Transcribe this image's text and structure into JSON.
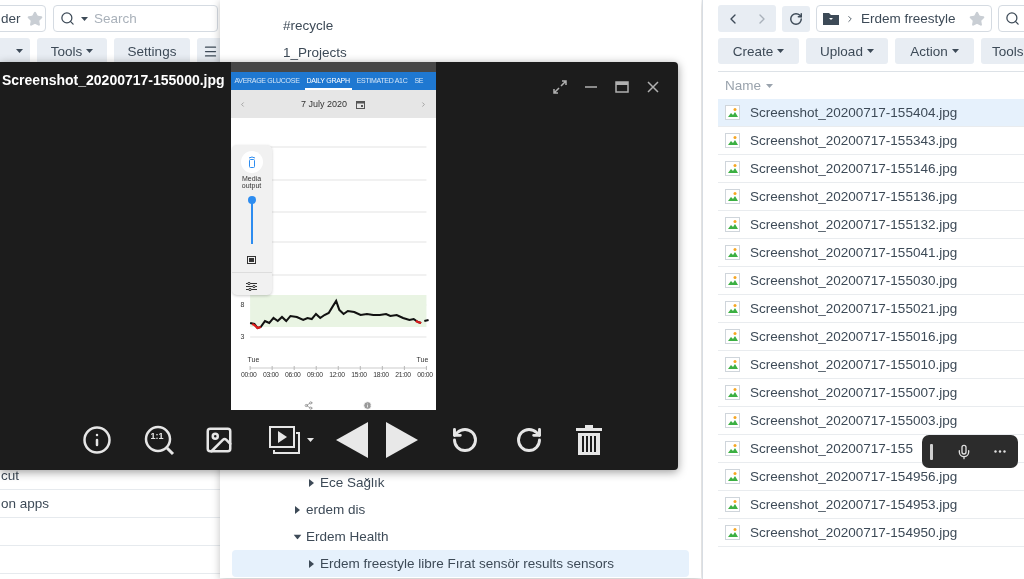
{
  "left_window": {
    "path_field": {
      "text": "der",
      "starred": false
    },
    "search": {
      "placeholder": "Search"
    },
    "toolbar": [
      {
        "kind": "caret"
      },
      {
        "kind": "dropdown",
        "label": "Tools"
      },
      {
        "kind": "plain",
        "label": "Settings"
      },
      {
        "kind": "menu"
      }
    ],
    "list": [
      "cut",
      "on apps"
    ]
  },
  "folder_tree": {
    "top": [
      {
        "label": "#recycle"
      },
      {
        "label": "1_Projects"
      }
    ],
    "bottom": [
      {
        "children": [
          {
            "label": "Ece Sağlık",
            "expanded": false,
            "selected": false
          }
        ]
      },
      {
        "label": "erdem dis",
        "expanded": false,
        "selected": false
      },
      {
        "label": "Erdem Health",
        "expanded": true,
        "selected": false,
        "children": [
          {
            "label": "Erdem freestyle libre Fırat sensör results sensors",
            "expanded": false,
            "selected": true
          }
        ]
      }
    ]
  },
  "viewer": {
    "title": "Screenshot_20200717-155000.jpg",
    "actual_size_label": "1:1",
    "image": {
      "tabs": [
        {
          "label": "AVERAGE GLUCOSE",
          "selected": false
        },
        {
          "label": "DAILY GRAPH",
          "selected": true
        },
        {
          "label": "ESTIMATED A1C",
          "selected": false
        },
        {
          "label": "SE",
          "selected": false
        }
      ],
      "date": "7 July 2020",
      "media_output": {
        "label": "Media output",
        "level": 0.95
      },
      "y_labels": [
        "8",
        "3"
      ],
      "day_labels": [
        "Tue",
        "Tue"
      ],
      "time_labels": [
        "00:00",
        "03:00",
        "06:00",
        "09:00",
        "12:00",
        "15:00",
        "18:00",
        "21:00",
        "00:00"
      ]
    }
  },
  "right_window": {
    "breadcrumb": {
      "folder": "Erdem freestyle",
      "starred": false
    },
    "toolbar": [
      "Create",
      "Upload",
      "Action",
      "Tools"
    ],
    "column": "Name",
    "files": [
      {
        "name": "Screenshot_20200717-155404.jpg",
        "selected": true
      },
      {
        "name": "Screenshot_20200717-155343.jpg",
        "selected": false
      },
      {
        "name": "Screenshot_20200717-155146.jpg",
        "selected": false
      },
      {
        "name": "Screenshot_20200717-155136.jpg",
        "selected": false
      },
      {
        "name": "Screenshot_20200717-155132.jpg",
        "selected": false
      },
      {
        "name": "Screenshot_20200717-155041.jpg",
        "selected": false
      },
      {
        "name": "Screenshot_20200717-155030.jpg",
        "selected": false
      },
      {
        "name": "Screenshot_20200717-155021.jpg",
        "selected": false
      },
      {
        "name": "Screenshot_20200717-155016.jpg",
        "selected": false
      },
      {
        "name": "Screenshot_20200717-155010.jpg",
        "selected": false
      },
      {
        "name": "Screenshot_20200717-155007.jpg",
        "selected": false
      },
      {
        "name": "Screenshot_20200717-155003.jpg",
        "selected": false
      },
      {
        "name": "Screenshot_20200717-155",
        "selected": false
      },
      {
        "name": "Screenshot_20200717-154956.jpg",
        "selected": false
      },
      {
        "name": "Screenshot_20200717-154953.jpg",
        "selected": false
      },
      {
        "name": "Screenshot_20200717-154950.jpg",
        "selected": false
      }
    ]
  }
}
